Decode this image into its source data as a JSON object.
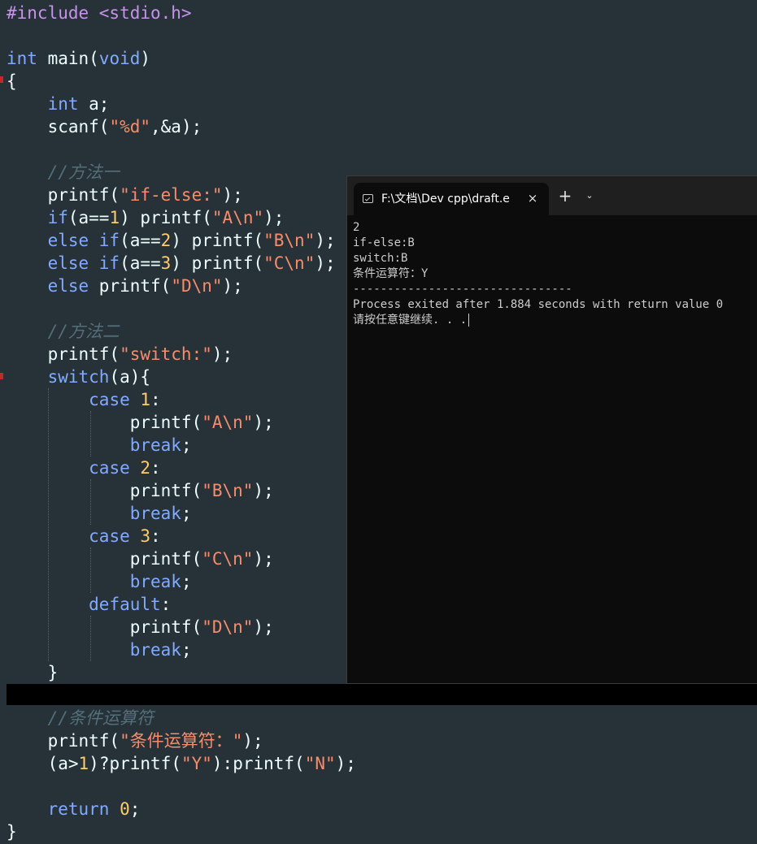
{
  "editor": {
    "code_lines": [
      [
        {
          "t": "#include <stdio.h>",
          "c": "pre"
        }
      ],
      [],
      [
        {
          "t": "int",
          "c": "kw"
        },
        {
          "t": " main(",
          "c": "pl"
        },
        {
          "t": "void",
          "c": "kw"
        },
        {
          "t": ")",
          "c": "pl"
        }
      ],
      [
        {
          "t": "{",
          "c": "pl"
        }
      ],
      [
        {
          "t": "    ",
          "c": "pl"
        },
        {
          "t": "int",
          "c": "kw"
        },
        {
          "t": " a;",
          "c": "pl"
        }
      ],
      [
        {
          "t": "    scanf(",
          "c": "pl"
        },
        {
          "t": "\"%d\"",
          "c": "str"
        },
        {
          "t": ",&a);",
          "c": "pl"
        }
      ],
      [],
      [
        {
          "t": "    //方法一",
          "c": "cm"
        }
      ],
      [
        {
          "t": "    printf(",
          "c": "pl"
        },
        {
          "t": "\"if-else:\"",
          "c": "str"
        },
        {
          "t": ");",
          "c": "pl"
        }
      ],
      [
        {
          "t": "    ",
          "c": "pl"
        },
        {
          "t": "if",
          "c": "kw"
        },
        {
          "t": "(a==",
          "c": "pl"
        },
        {
          "t": "1",
          "c": "num"
        },
        {
          "t": ") printf(",
          "c": "pl"
        },
        {
          "t": "\"A\\n\"",
          "c": "str"
        },
        {
          "t": ");",
          "c": "pl"
        }
      ],
      [
        {
          "t": "    ",
          "c": "pl"
        },
        {
          "t": "else if",
          "c": "kw"
        },
        {
          "t": "(a==",
          "c": "pl"
        },
        {
          "t": "2",
          "c": "num"
        },
        {
          "t": ") printf(",
          "c": "pl"
        },
        {
          "t": "\"B\\n\"",
          "c": "str"
        },
        {
          "t": ");",
          "c": "pl"
        }
      ],
      [
        {
          "t": "    ",
          "c": "pl"
        },
        {
          "t": "else if",
          "c": "kw"
        },
        {
          "t": "(a==",
          "c": "pl"
        },
        {
          "t": "3",
          "c": "num"
        },
        {
          "t": ") printf(",
          "c": "pl"
        },
        {
          "t": "\"C\\n\"",
          "c": "str"
        },
        {
          "t": ");",
          "c": "pl"
        }
      ],
      [
        {
          "t": "    ",
          "c": "pl"
        },
        {
          "t": "else",
          "c": "kw"
        },
        {
          "t": " printf(",
          "c": "pl"
        },
        {
          "t": "\"D\\n\"",
          "c": "str"
        },
        {
          "t": ");",
          "c": "pl"
        }
      ],
      [],
      [
        {
          "t": "    //方法二",
          "c": "cm"
        }
      ],
      [
        {
          "t": "    printf(",
          "c": "pl"
        },
        {
          "t": "\"switch:\"",
          "c": "str"
        },
        {
          "t": ");",
          "c": "pl"
        }
      ],
      [
        {
          "t": "    ",
          "c": "pl"
        },
        {
          "t": "switch",
          "c": "kw"
        },
        {
          "t": "(a){",
          "c": "pl"
        }
      ],
      [
        {
          "t": "        ",
          "c": "pl"
        },
        {
          "t": "case",
          "c": "kw"
        },
        {
          "t": " ",
          "c": "pl"
        },
        {
          "t": "1",
          "c": "num"
        },
        {
          "t": ":",
          "c": "pl"
        }
      ],
      [
        {
          "t": "            printf(",
          "c": "pl"
        },
        {
          "t": "\"A\\n\"",
          "c": "str"
        },
        {
          "t": ");",
          "c": "pl"
        }
      ],
      [
        {
          "t": "            ",
          "c": "pl"
        },
        {
          "t": "break",
          "c": "kw"
        },
        {
          "t": ";",
          "c": "pl"
        }
      ],
      [
        {
          "t": "        ",
          "c": "pl"
        },
        {
          "t": "case",
          "c": "kw"
        },
        {
          "t": " ",
          "c": "pl"
        },
        {
          "t": "2",
          "c": "num"
        },
        {
          "t": ":",
          "c": "pl"
        }
      ],
      [
        {
          "t": "            printf(",
          "c": "pl"
        },
        {
          "t": "\"B\\n\"",
          "c": "str"
        },
        {
          "t": ");",
          "c": "pl"
        }
      ],
      [
        {
          "t": "            ",
          "c": "pl"
        },
        {
          "t": "break",
          "c": "kw"
        },
        {
          "t": ";",
          "c": "pl"
        }
      ],
      [
        {
          "t": "        ",
          "c": "pl"
        },
        {
          "t": "case",
          "c": "kw"
        },
        {
          "t": " ",
          "c": "pl"
        },
        {
          "t": "3",
          "c": "num"
        },
        {
          "t": ":",
          "c": "pl"
        }
      ],
      [
        {
          "t": "            printf(",
          "c": "pl"
        },
        {
          "t": "\"C\\n\"",
          "c": "str"
        },
        {
          "t": ");",
          "c": "pl"
        }
      ],
      [
        {
          "t": "            ",
          "c": "pl"
        },
        {
          "t": "break",
          "c": "kw"
        },
        {
          "t": ";",
          "c": "pl"
        }
      ],
      [
        {
          "t": "        ",
          "c": "pl"
        },
        {
          "t": "default",
          "c": "kw"
        },
        {
          "t": ":",
          "c": "pl"
        }
      ],
      [
        {
          "t": "            printf(",
          "c": "pl"
        },
        {
          "t": "\"D\\n\"",
          "c": "str"
        },
        {
          "t": ");",
          "c": "pl"
        }
      ],
      [
        {
          "t": "            ",
          "c": "pl"
        },
        {
          "t": "break",
          "c": "kw"
        },
        {
          "t": ";",
          "c": "pl"
        }
      ],
      [
        {
          "t": "    }",
          "c": "pl"
        }
      ],
      [],
      [
        {
          "t": "    //条件运算符",
          "c": "cm"
        }
      ],
      [
        {
          "t": "    printf(",
          "c": "pl"
        },
        {
          "t": "\"条件运算符：\"",
          "c": "str"
        },
        {
          "t": ");",
          "c": "pl"
        }
      ],
      [
        {
          "t": "    (a>",
          "c": "pl"
        },
        {
          "t": "1",
          "c": "num"
        },
        {
          "t": ")?printf(",
          "c": "pl"
        },
        {
          "t": "\"Y\"",
          "c": "str"
        },
        {
          "t": "):printf(",
          "c": "pl"
        },
        {
          "t": "\"N\"",
          "c": "str"
        },
        {
          "t": ");",
          "c": "pl"
        }
      ],
      [],
      [
        {
          "t": "    ",
          "c": "pl"
        },
        {
          "t": "return",
          "c": "kw"
        },
        {
          "t": " ",
          "c": "pl"
        },
        {
          "t": "0",
          "c": "num"
        },
        {
          "t": ";",
          "c": "pl"
        }
      ],
      [
        {
          "t": "}",
          "c": "pl"
        }
      ]
    ]
  },
  "terminal": {
    "tab_title": "F:\\文档\\Dev cpp\\draft.e",
    "close_symbol": "×",
    "new_tab_symbol": "+",
    "dropdown_symbol": "⌄",
    "icon": "terminal-icon",
    "output_lines": [
      "2",
      "if-else:B",
      "switch:B",
      "条件运算符：Y",
      "--------------------------------",
      "Process exited after 1.884 seconds with return value 0",
      "请按任意键继续. . ."
    ]
  },
  "colors": {
    "editor_bg": "#263238",
    "keyword": "#82aaff",
    "string": "#f78c6c",
    "number": "#ffcb6b",
    "comment": "#546e7a",
    "preprocessor": "#c792ea",
    "plain": "#eeffff",
    "terminal_bg": "#0c0c0c",
    "terminal_text": "#cccccc"
  }
}
